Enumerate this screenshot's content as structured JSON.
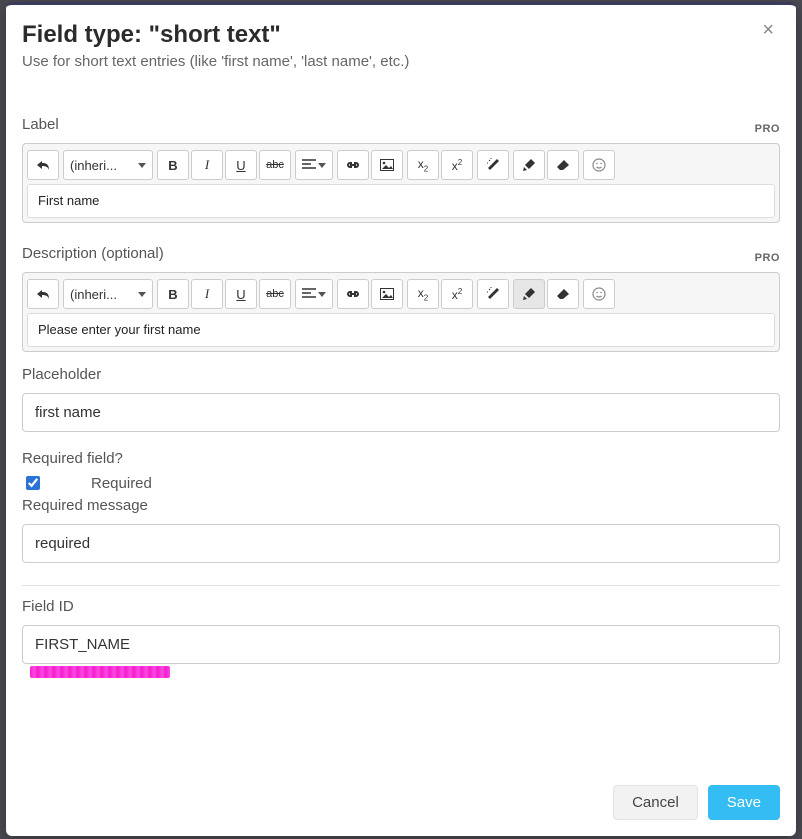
{
  "modal": {
    "title": "Field type: \"short text\"",
    "subtitle": "Use for short text entries (like 'first name', 'last name', etc.)"
  },
  "labels": {
    "label": "Label",
    "description": "Description (optional)",
    "placeholder": "Placeholder",
    "required_field": "Required field?",
    "required": "Required",
    "required_message": "Required message",
    "field_id": "Field ID",
    "pro": "PRO"
  },
  "toolbar": {
    "font": "(inheri..."
  },
  "values": {
    "label_content": "First name",
    "description_content": "Please enter your first name",
    "placeholder": "first name",
    "required_checked": true,
    "required_message": "required",
    "field_id": "FIRST_NAME"
  },
  "buttons": {
    "cancel": "Cancel",
    "save": "Save"
  }
}
